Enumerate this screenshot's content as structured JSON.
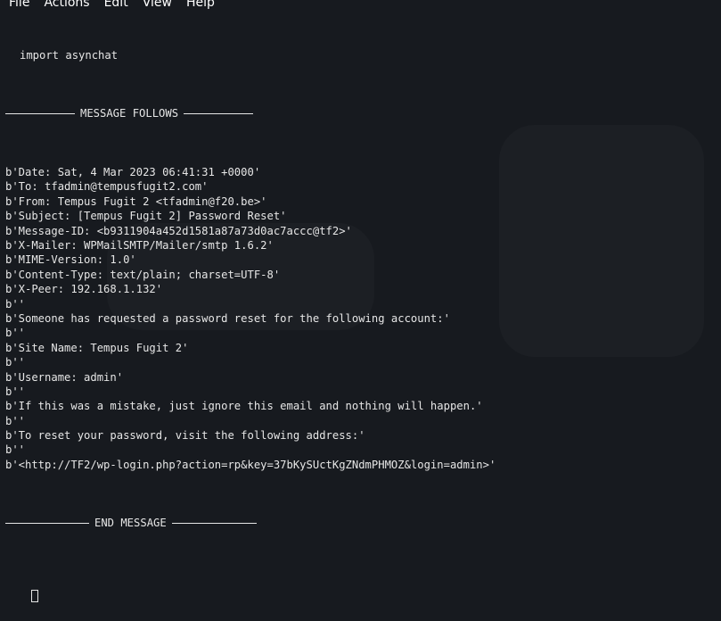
{
  "menubar": {
    "items": [
      "File",
      "Actions",
      "Edit",
      "View",
      "Help"
    ]
  },
  "terminal": {
    "first_line": "import asynchat",
    "header_separator": "MESSAGE FOLLOWS",
    "lines": [
      "b'Date: Sat, 4 Mar 2023 06:41:31 +0000'",
      "b'To: tfadmin@tempusfugit2.com'",
      "b'From: Tempus Fugit 2 <tfadmin@f20.be>'",
      "b'Subject: [Tempus Fugit 2] Password Reset'",
      "b'Message-ID: <b9311904a452d1581a87a73d0ac7accc@tf2>'",
      "b'X-Mailer: WPMailSMTP/Mailer/smtp 1.6.2'",
      "b'MIME-Version: 1.0'",
      "b'Content-Type: text/plain; charset=UTF-8'",
      "b'X-Peer: 192.168.1.132'",
      "b''",
      "b'Someone has requested a password reset for the following account:'",
      "b''",
      "b'Site Name: Tempus Fugit 2'",
      "b''",
      "b'Username: admin'",
      "b''",
      "b'If this was a mistake, just ignore this email and nothing will happen.'",
      "b''",
      "b'To reset your password, visit the following address:'",
      "b''",
      "b'<http://TF2/wp-login.php?action=rp&key=37bKySUctKgZNdmPHMOZ&login=admin>'"
    ],
    "footer_separator": "END MESSAGE"
  }
}
